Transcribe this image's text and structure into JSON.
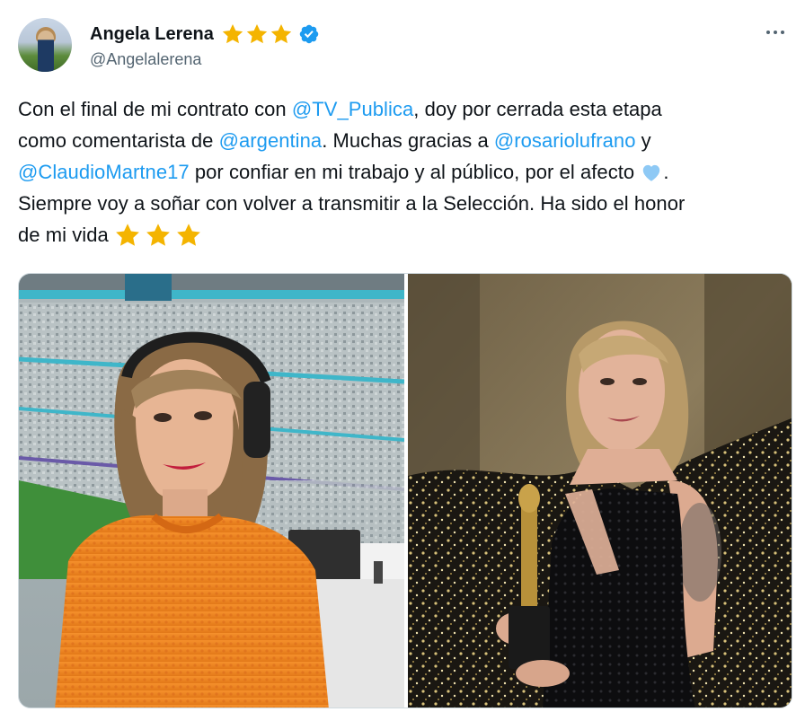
{
  "author": {
    "display_name": "Angela Lerena",
    "handle": "@Angelalerena",
    "badge_stars": 3,
    "verified": true
  },
  "menu": {
    "icon": "more-horizontal-icon"
  },
  "tweet": {
    "lines": [
      [
        {
          "t": "text",
          "v": "Con el final de mi contrato con "
        },
        {
          "t": "mention",
          "v": "@TV_Publica"
        },
        {
          "t": "text",
          "v": ", doy por cerrada esta etapa"
        }
      ],
      [
        {
          "t": "text",
          "v": "como comentarista de "
        },
        {
          "t": "mention",
          "v": "@argentina"
        },
        {
          "t": "text",
          "v": ". Muchas gracias a "
        },
        {
          "t": "mention",
          "v": "@rosariolufrano"
        },
        {
          "t": "text",
          "v": " y"
        }
      ],
      [
        {
          "t": "mention",
          "v": "@ClaudioMartne17"
        },
        {
          "t": "text",
          "v": " por confiar en mi trabajo y al público, por el afecto "
        },
        {
          "t": "heart",
          "v": "blue-heart-emoji"
        },
        {
          "t": "text",
          "v": "."
        }
      ],
      [
        {
          "t": "text",
          "v": "Siempre voy a soñar con volver a transmitir a la Selección. Ha sido el honor"
        }
      ],
      [
        {
          "t": "text",
          "v": "de mi vida "
        },
        {
          "t": "stars",
          "v": "star-emoji"
        }
      ]
    ]
  },
  "media": {
    "photos": [
      {
        "name": "photo-commentator-booth-stadium"
      },
      {
        "name": "photo-award-black-dress"
      }
    ]
  },
  "colors": {
    "mention": "#1d9bf0",
    "star": "#f4b400",
    "verified": "#1d9bf0",
    "heart": "#8ec9f5"
  }
}
